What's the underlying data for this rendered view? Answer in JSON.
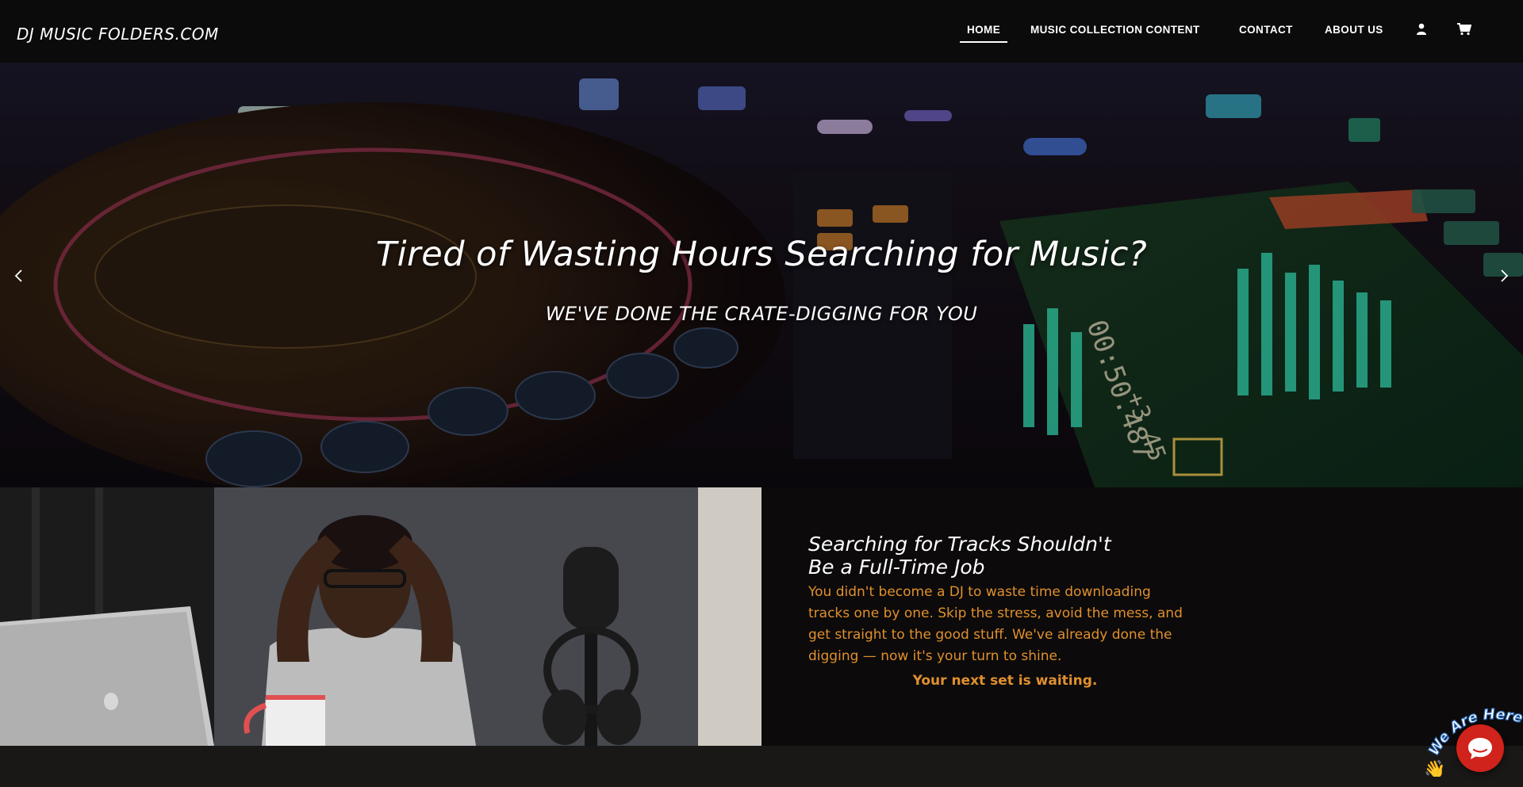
{
  "header": {
    "logo": "DJ MUSIC FOLDERS.COM",
    "nav": [
      {
        "label": "HOME",
        "active": true
      },
      {
        "label": "MUSIC COLLECTION CONTENT",
        "active": false
      },
      {
        "label": "CONTACT",
        "active": false
      },
      {
        "label": "ABOUT US",
        "active": false
      }
    ],
    "icons": [
      "user-icon",
      "cart-icon"
    ]
  },
  "hero": {
    "title": "Tired of Wasting Hours Searching for Music?",
    "subtitle": "WE'VE DONE THE CRATE-DIGGING FOR YOU",
    "prev_icon": "chevron-left-icon",
    "next_icon": "chevron-right-icon"
  },
  "section": {
    "title_line1": "Searching for Tracks Shouldn't",
    "title_line2": "Be a Full-Time Job",
    "body": "You didn't become a DJ to waste time downloading tracks one by one. Skip the stress, avoid the mess, and get straight to the good stuff. We've already done the digging — now it's your turn to shine.",
    "cta": "Your next set is waiting.",
    "accent_color": "#e0902e"
  },
  "chat": {
    "badge_text": "We Are Here!",
    "icon": "chat-bubble-icon",
    "color": "#d0231b"
  }
}
